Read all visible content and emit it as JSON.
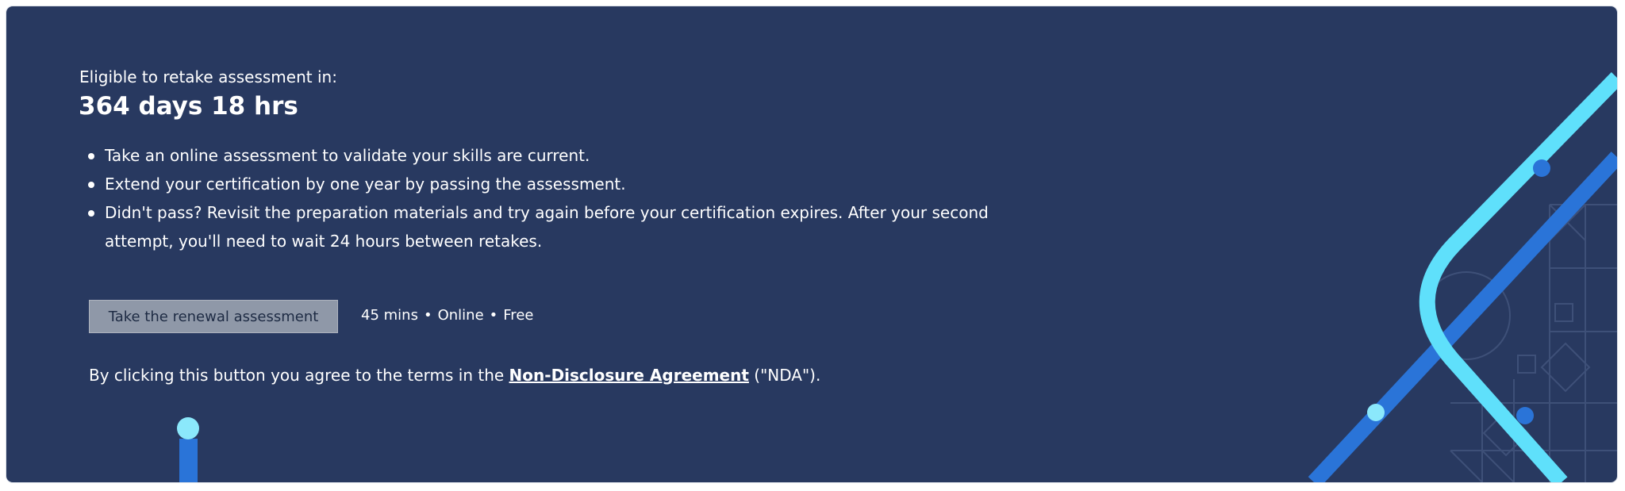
{
  "colors": {
    "background": "#283960",
    "accent_light": "#5fe0fb",
    "accent_dark": "#2a74d8",
    "button_disabled": "#8f98a8"
  },
  "retake": {
    "label": "Eligible to retake assessment in:",
    "countdown": "364 days 18 hrs"
  },
  "bullets": [
    "Take an online assessment to validate your skills are current.",
    "Extend your certification by one year by passing the assessment.",
    "Didn't pass? Revisit the preparation materials and try again before your certification expires. After your second attempt, you'll need to wait 24 hours between retakes."
  ],
  "renewal": {
    "button_label": "Take the renewal assessment",
    "button_state": "disabled",
    "duration": "45 mins",
    "mode": "Online",
    "price": "Free",
    "separator": "•"
  },
  "agreement": {
    "prefix": "By clicking this button you agree to the terms in the",
    "link_text": "Non-Disclosure Agreement",
    "suffix": "(\"NDA\")."
  }
}
